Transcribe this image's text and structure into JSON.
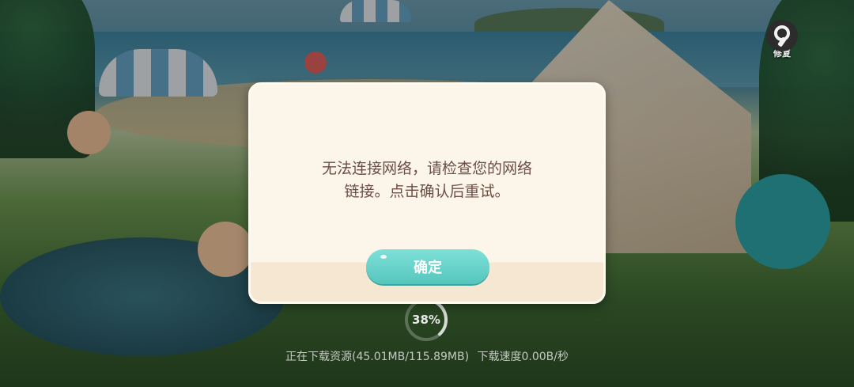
{
  "dialog": {
    "message_line1": "无法连接网络，请检查您的网络",
    "message_line2": "链接。点击确认后重试。",
    "confirm_label": "确定"
  },
  "repair": {
    "label": "修复",
    "icon": "wrench-icon"
  },
  "download": {
    "progress_text": "38%",
    "progress_fraction": 0.38,
    "status_resources": "正在下载资源(45.01MB/115.89MB)",
    "status_speed": "下载速度0.00B/秒"
  },
  "colors": {
    "confirm_button": "#5ccac1",
    "dialog_bg": "#fbf5ea",
    "message_text": "#6e4e44"
  }
}
